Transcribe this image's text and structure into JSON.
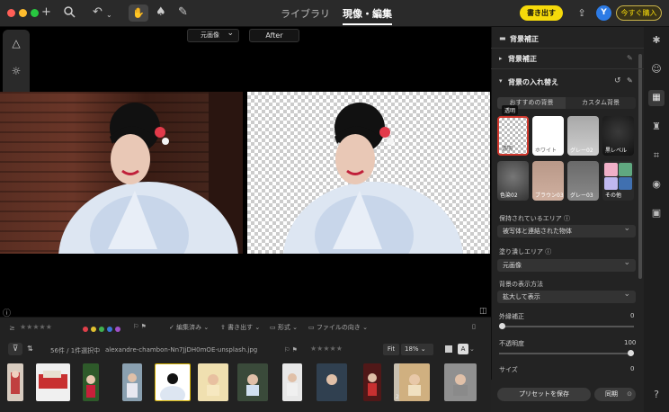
{
  "toolbar": {
    "tabs": [
      {
        "label": "ライブラリ"
      },
      {
        "label": "現像・編集"
      }
    ],
    "buy_label": "書き出す",
    "avatar_initial": "Y",
    "purchase_label": "今すぐ購入"
  },
  "viewer": {
    "compare_left_label": "元画像",
    "compare_right_label": "After"
  },
  "filmstrip": {
    "status_edited": "編集済み",
    "status_export": "書き出す",
    "status_format": "形式",
    "status_orientation": "ファイルの向き",
    "count_text": "56件 / 1件選択中",
    "filename": "alexandre-chambon-Nn7JjDH0mOE-unsplash.jpg",
    "fit_label": "Fit",
    "zoom_value": "18%",
    "badge_29": "29"
  },
  "panel": {
    "title": "背景補正",
    "section_bg_correction": "背景補正",
    "section_bg_replace": "背景の入れ替え",
    "tab_recommended": "おすすめの背景",
    "tab_custom": "カスタム背景",
    "tooltip": "透明",
    "swatches": [
      {
        "label": "透明"
      },
      {
        "label": "ホワイト"
      },
      {
        "label": "グレー02"
      },
      {
        "label": "黒レベル"
      },
      {
        "label": "色染02"
      },
      {
        "label": "ブラウン03"
      },
      {
        "label": "グレー03"
      },
      {
        "label": "その他"
      }
    ],
    "kept_area_label": "保持されているエリア",
    "kept_area_value": "被写体と連結された物体",
    "fill_area_label": "塗り潰しエリア",
    "fill_area_value": "元画像",
    "display_label": "背景の表示方法",
    "display_value": "拡大して表示",
    "outer_label": "外縁補正",
    "outer_value": "0",
    "opacity_label": "不透明度",
    "opacity_value": "100",
    "size_label": "サイズ",
    "size_value": "0",
    "save_preset_label": "プリセットを保存",
    "sync_label": "同期"
  },
  "sliders": {
    "outer": 0,
    "opacity": 1.0,
    "size": 0
  },
  "colors": {
    "accent": "#f5d90a",
    "selection": "#d8b400",
    "selected_swatch_border": "#d0392f"
  }
}
